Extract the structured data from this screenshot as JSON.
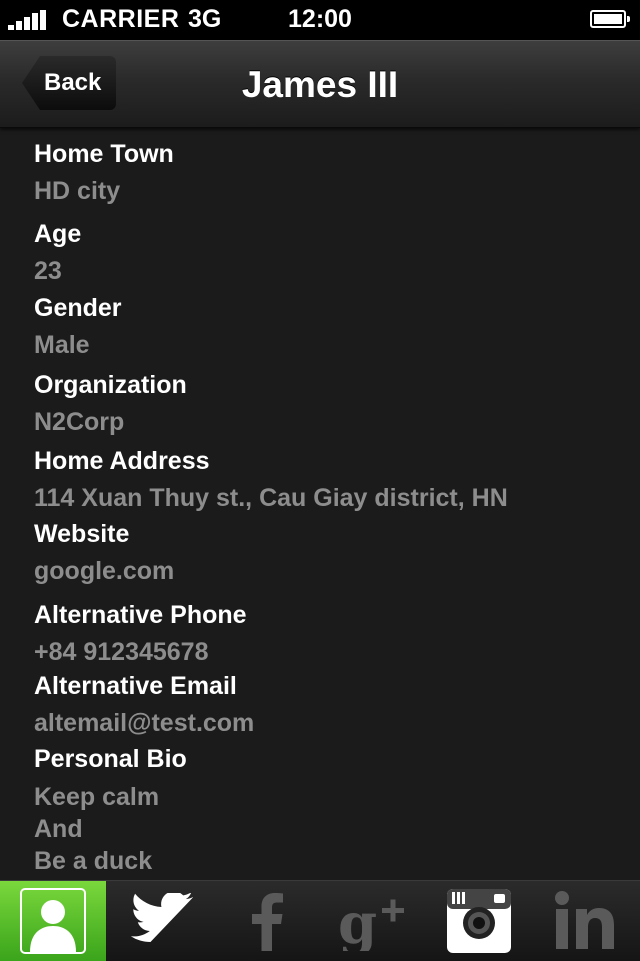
{
  "status_bar": {
    "carrier": "CARRIER",
    "network": "3G",
    "time": "12:00"
  },
  "nav": {
    "back_label": "Back",
    "title": "James III"
  },
  "fields": [
    {
      "label": "Home Town",
      "value": "HD city"
    },
    {
      "label": "Age",
      "value": "23"
    },
    {
      "label": "Gender",
      "value": "Male"
    },
    {
      "label": "Organization",
      "value": "N2Corp"
    },
    {
      "label": "Home Address",
      "value": "114 Xuan Thuy st., Cau Giay district, HN"
    },
    {
      "label": "Website",
      "value": "google.com"
    },
    {
      "label": "Alternative Phone",
      "value": "+84 912345678"
    },
    {
      "label": "Alternative Email",
      "value": "altemail@test.com"
    },
    {
      "label": "Personal Bio",
      "lines": [
        "Keep calm",
        "And",
        "Be a duck"
      ]
    }
  ],
  "tabs": [
    {
      "icon": "profile-icon",
      "active": true
    },
    {
      "icon": "twitter-icon",
      "active": false
    },
    {
      "icon": "facebook-icon",
      "active": false
    },
    {
      "icon": "google-plus-icon",
      "active": false
    },
    {
      "icon": "instagram-icon",
      "active": false
    },
    {
      "icon": "linkedin-icon",
      "active": false
    }
  ],
  "colors": {
    "active_tab": "#4bb826",
    "label": "#ffffff",
    "value": "#8d8d8d",
    "background": "#1b1b1b"
  }
}
